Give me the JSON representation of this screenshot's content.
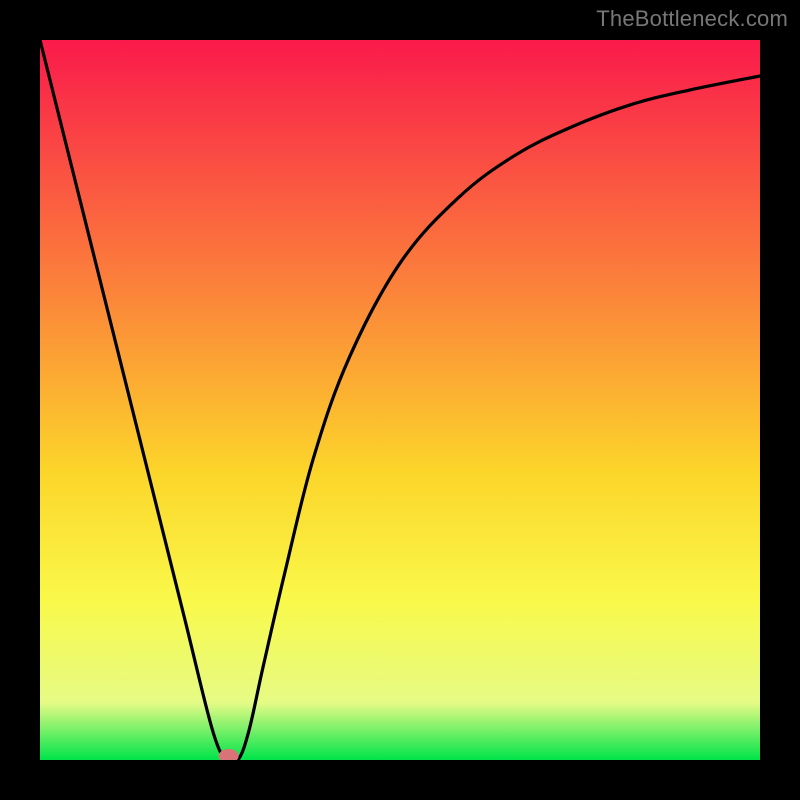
{
  "watermark": "TheBottleneck.com",
  "colors": {
    "frame": "#000000",
    "gradient_top": "#fa1a4b",
    "gradient_mid1": "#fb843a",
    "gradient_mid2": "#fcd52a",
    "gradient_mid3": "#f9f94a",
    "gradient_mid4": "#e6fb85",
    "gradient_bot": "#00e44a",
    "curve": "#000000",
    "marker_fill": "#da7377",
    "marker_stroke": "#da7377"
  },
  "chart_data": {
    "type": "line",
    "title": "",
    "xlabel": "",
    "ylabel": "",
    "xlim": [
      0,
      100
    ],
    "ylim": [
      0,
      100
    ],
    "grid": false,
    "series": [
      {
        "name": "line",
        "x": [
          0,
          5,
          10,
          15,
          20,
          24,
          26,
          27.5,
          29,
          31,
          34,
          38,
          43,
          50,
          58,
          66,
          74,
          82,
          90,
          100
        ],
        "y": [
          100,
          80,
          60,
          40,
          20,
          4,
          0,
          0,
          4,
          13,
          26,
          42,
          56,
          69,
          78,
          84,
          88,
          91,
          93,
          95
        ]
      }
    ],
    "marker": {
      "x": 26.2,
      "y": 0,
      "label": ""
    },
    "annotations": []
  }
}
